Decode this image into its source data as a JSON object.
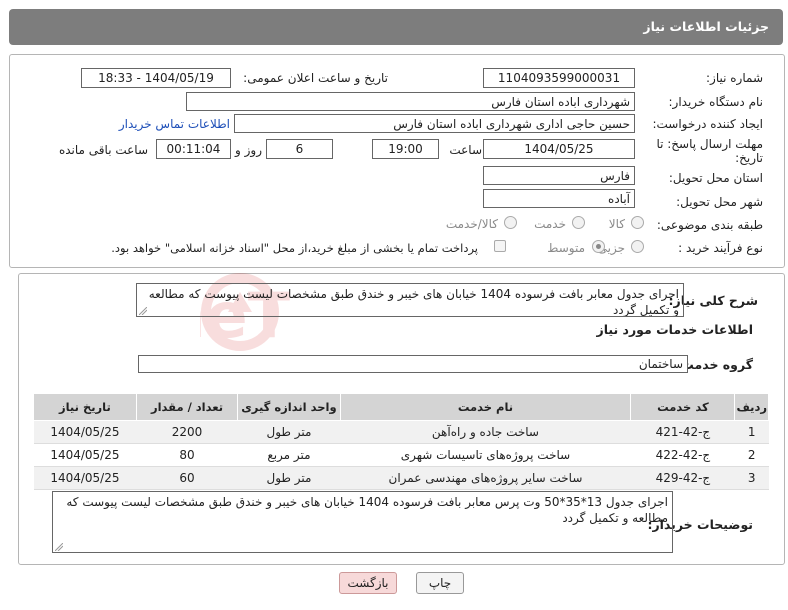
{
  "header": {
    "title": "جزئیات اطلاعات نیاز"
  },
  "fields": {
    "need_number_label": "شماره نیاز:",
    "need_number": "1104093599000031",
    "announce_label": "تاریخ و ساعت اعلان عمومی:",
    "announce_value": "1404/05/19 - 18:33",
    "buyer_org_label": "نام دستگاه خریدار:",
    "buyer_org": "شهرداری اباده استان فارس",
    "creator_label": "ایجاد کننده درخواست:",
    "creator": "حسین حاجی اداری شهرداری اباده استان فارس",
    "contact_link": "اطلاعات تماس خریدار",
    "deadline_label_1": "مهلت ارسال پاسخ: تا",
    "deadline_label_2": "تاریخ:",
    "deadline_date": "1404/05/25",
    "time_label": "ساعت",
    "deadline_time": "19:00",
    "days_value": "6",
    "days_label": "روز و",
    "remaining_time": "00:11:04",
    "remaining_label": "ساعت باقی مانده",
    "province_label": "استان محل تحویل:",
    "province": "فارس",
    "city_label": "شهر محل تحویل:",
    "city": "آباده",
    "category_label": "طبقه بندی موضوعی:",
    "cat_options": [
      "کالا",
      "خدمت",
      "کالا/خدمت"
    ],
    "purchase_type_label": "نوع فرآیند خرید :",
    "purchase_options": [
      "جزیی",
      "متوسط"
    ],
    "payment_note": "پرداخت تمام یا بخشی از مبلغ خرید،از محل \"اسناد خزانه اسلامی\" خواهد بود."
  },
  "summary": {
    "label": "شرح کلی نیاز:",
    "text": "اجرای جدول معابر بافت فرسوده 1404 خیابان های خیبر و خندق طبق مشخصات لیست پیوست که مطالعه و تکمیل گردد"
  },
  "services": {
    "section_title": "اطلاعات خدمات مورد نیاز",
    "group_label": "گروه خدمت:",
    "group_value": "ساختمان",
    "columns": [
      "ردیف",
      "کد خدمت",
      "نام خدمت",
      "واحد اندازه گیری",
      "تعداد / مقدار",
      "تاریخ نیاز"
    ],
    "rows": [
      [
        "1",
        "ج-42-421",
        "ساخت جاده و راه‌آهن",
        "متر طول",
        "2200",
        "1404/05/25"
      ],
      [
        "2",
        "ج-42-422",
        "ساخت پروژه‌های تاسیسات شهری",
        "متر مربع",
        "80",
        "1404/05/25"
      ],
      [
        "3",
        "ج-42-429",
        "ساخت سایر پروژه‌های مهندسی عمران",
        "متر طول",
        "60",
        "1404/05/25"
      ]
    ]
  },
  "buyer_notes": {
    "label": "توضیحات خریدار:",
    "text": "اجرای جدول 13*35*50 وت پرس معابر بافت فرسوده 1404 خیابان های خیبر و خندق طبق مشخصات لیست پیوست که مطالعه و تکمیل گردد"
  },
  "buttons": {
    "print": "چاپ",
    "back": "بازگشت"
  },
  "watermark": "AriaTender.neT"
}
